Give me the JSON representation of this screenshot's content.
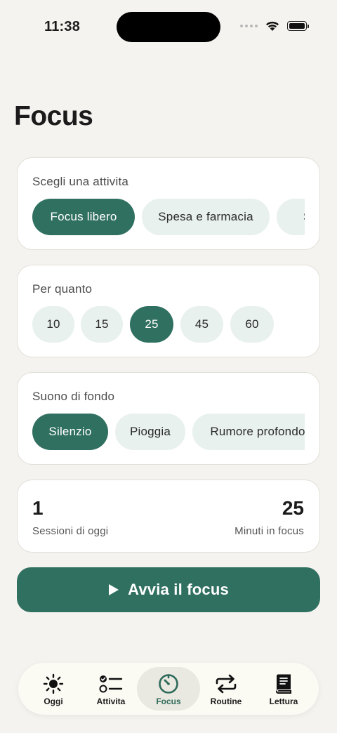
{
  "status_bar": {
    "time": "11:38"
  },
  "page": {
    "title": "Focus"
  },
  "activity": {
    "label": "Scegli una attivita",
    "chips": [
      "Focus libero",
      "Spesa e farmacia",
      "Scrivere"
    ],
    "selected": "Focus libero"
  },
  "duration": {
    "label": "Per quanto",
    "options": [
      "10",
      "15",
      "25",
      "45",
      "60"
    ],
    "selected": "25"
  },
  "sound": {
    "label": "Suono di fondo",
    "chips": [
      "Silenzio",
      "Pioggia",
      "Rumore profondo"
    ],
    "selected": "Silenzio"
  },
  "stats": {
    "sessions_value": "1",
    "sessions_label": "Sessioni di oggi",
    "minutes_value": "25",
    "minutes_label": "Minuti in focus"
  },
  "start_button": {
    "label": "Avvia il focus",
    "icon": "play-icon"
  },
  "tabbar": {
    "active": "Focus",
    "tabs": [
      {
        "label": "Oggi",
        "icon": "sun-icon"
      },
      {
        "label": "Attivita",
        "icon": "checklist-icon"
      },
      {
        "label": "Focus",
        "icon": "timer-icon"
      },
      {
        "label": "Routine",
        "icon": "repeat-icon"
      },
      {
        "label": "Lettura",
        "icon": "book-icon"
      }
    ]
  },
  "colors": {
    "accent": "#307060",
    "chip_bg": "#e8f1ee",
    "background": "#f5f3ef",
    "card": "#ffffff"
  }
}
